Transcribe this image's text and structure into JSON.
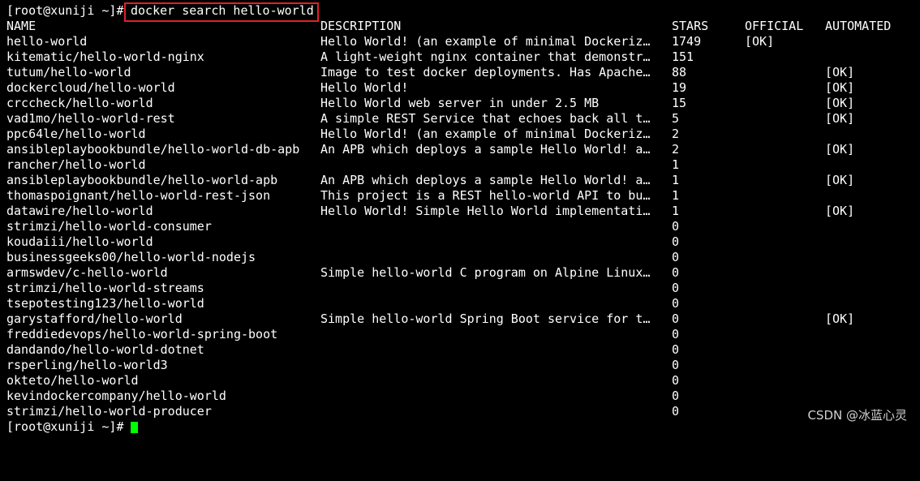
{
  "terminal": {
    "prompt": "[root@xuniji ~]#",
    "command": "docker search hello-world",
    "final_prompt": "[root@xuniji ~]#",
    "cursor_color": "#00ff00",
    "highlight_color": "#e0202a"
  },
  "table": {
    "headers": {
      "name": "NAME",
      "description": "DESCRIPTION",
      "stars": "STARS",
      "official": "OFFICIAL",
      "automated": "AUTOMATED"
    },
    "rows": [
      {
        "name": "hello-world",
        "description": "Hello World! (an example of minimal Dockeriz…",
        "stars": "1749",
        "official": "[OK]",
        "automated": ""
      },
      {
        "name": "kitematic/hello-world-nginx",
        "description": "A light-weight nginx container that demonstr…",
        "stars": "151",
        "official": "",
        "automated": ""
      },
      {
        "name": "tutum/hello-world",
        "description": "Image to test docker deployments. Has Apache…",
        "stars": "88",
        "official": "",
        "automated": "[OK]"
      },
      {
        "name": "dockercloud/hello-world",
        "description": "Hello World!",
        "stars": "19",
        "official": "",
        "automated": "[OK]"
      },
      {
        "name": "crccheck/hello-world",
        "description": "Hello World web server in under 2.5 MB",
        "stars": "15",
        "official": "",
        "automated": "[OK]"
      },
      {
        "name": "vad1mo/hello-world-rest",
        "description": "A simple REST Service that echoes back all t…",
        "stars": "5",
        "official": "",
        "automated": "[OK]"
      },
      {
        "name": "ppc64le/hello-world",
        "description": "Hello World! (an example of minimal Dockeriz…",
        "stars": "2",
        "official": "",
        "automated": ""
      },
      {
        "name": "ansibleplaybookbundle/hello-world-db-apb",
        "description": "An APB which deploys a sample Hello World! a…",
        "stars": "2",
        "official": "",
        "automated": "[OK]"
      },
      {
        "name": "rancher/hello-world",
        "description": "",
        "stars": "1",
        "official": "",
        "automated": ""
      },
      {
        "name": "ansibleplaybookbundle/hello-world-apb",
        "description": "An APB which deploys a sample Hello World! a…",
        "stars": "1",
        "official": "",
        "automated": "[OK]"
      },
      {
        "name": "thomaspoignant/hello-world-rest-json",
        "description": "This project is a REST hello-world API to bu…",
        "stars": "1",
        "official": "",
        "automated": ""
      },
      {
        "name": "datawire/hello-world",
        "description": "Hello World! Simple Hello World implementati…",
        "stars": "1",
        "official": "",
        "automated": "[OK]"
      },
      {
        "name": "strimzi/hello-world-consumer",
        "description": "",
        "stars": "0",
        "official": "",
        "automated": ""
      },
      {
        "name": "koudaiii/hello-world",
        "description": "",
        "stars": "0",
        "official": "",
        "automated": ""
      },
      {
        "name": "businessgeeks00/hello-world-nodejs",
        "description": "",
        "stars": "0",
        "official": "",
        "automated": ""
      },
      {
        "name": "armswdev/c-hello-world",
        "description": "Simple hello-world C program on Alpine Linux…",
        "stars": "0",
        "official": "",
        "automated": ""
      },
      {
        "name": "strimzi/hello-world-streams",
        "description": "",
        "stars": "0",
        "official": "",
        "automated": ""
      },
      {
        "name": "tsepotesting123/hello-world",
        "description": "",
        "stars": "0",
        "official": "",
        "automated": ""
      },
      {
        "name": "garystafford/hello-world",
        "description": "Simple hello-world Spring Boot service for t…",
        "stars": "0",
        "official": "",
        "automated": "[OK]"
      },
      {
        "name": "freddiedevops/hello-world-spring-boot",
        "description": "",
        "stars": "0",
        "official": "",
        "automated": ""
      },
      {
        "name": "dandando/hello-world-dotnet",
        "description": "",
        "stars": "0",
        "official": "",
        "automated": ""
      },
      {
        "name": "rsperling/hello-world3",
        "description": "",
        "stars": "0",
        "official": "",
        "automated": ""
      },
      {
        "name": "okteto/hello-world",
        "description": "",
        "stars": "0",
        "official": "",
        "automated": ""
      },
      {
        "name": "kevindockercompany/hello-world",
        "description": "",
        "stars": "0",
        "official": "",
        "automated": ""
      },
      {
        "name": "strimzi/hello-world-producer",
        "description": "",
        "stars": "0",
        "official": "",
        "automated": ""
      }
    ]
  },
  "watermark": "CSDN @冰蓝心灵"
}
